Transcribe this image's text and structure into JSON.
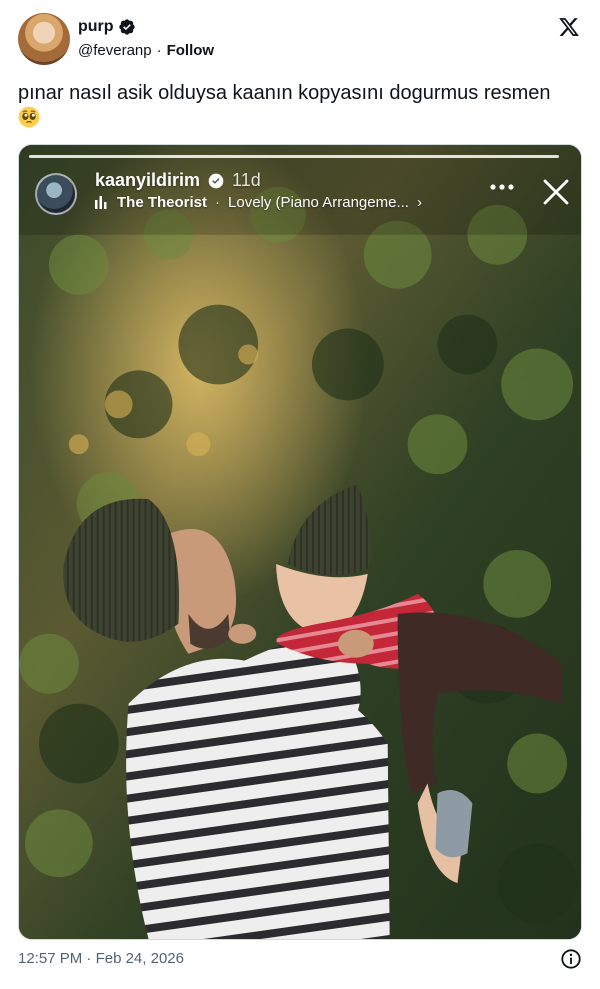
{
  "author": {
    "name": "purp",
    "handle": "@feveranp",
    "separator": "·",
    "follow_label": "Follow"
  },
  "tweet": {
    "text": "pınar nasıl asik olduysa kaanın kopyasını dogurmus resmen",
    "emoji": "pleading-face-emoji"
  },
  "story": {
    "username": "kaanyildirim",
    "age": "11d",
    "music_artist": "The Theorist",
    "music_separator": "·",
    "music_track": "Lovely (Piano Arrangeme...",
    "chevron": "›"
  },
  "footer": {
    "time": "12:57 PM",
    "separator": "·",
    "date": "Feb 24, 2026"
  },
  "colors": {
    "text": "#0f1419",
    "muted": "#536471",
    "verified": "#0f1419"
  },
  "icons": [
    "verified-badge-icon",
    "x-logo-icon",
    "music-bars-icon",
    "more-icon",
    "close-icon",
    "info-icon"
  ]
}
